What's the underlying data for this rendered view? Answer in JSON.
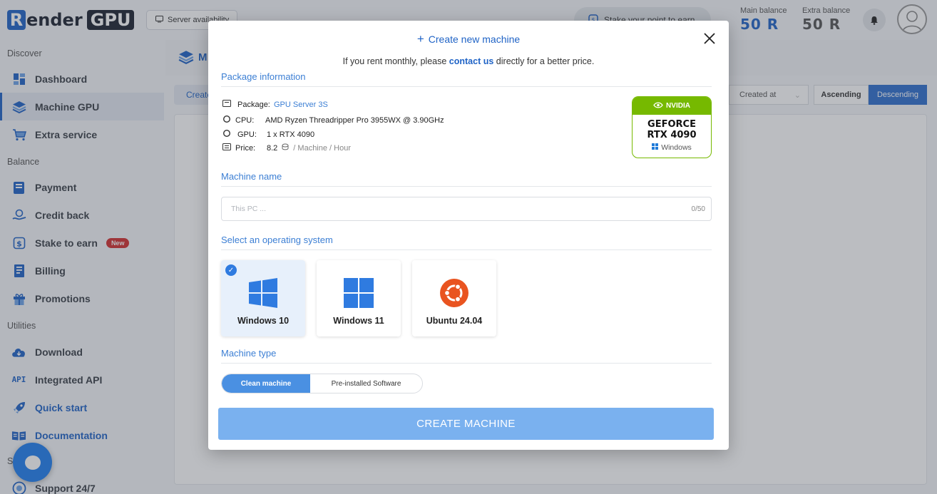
{
  "header": {
    "logo_left": "R",
    "logo_mid": "ender",
    "logo_right": "GPU",
    "server_availability": "Server availability",
    "stake_pill": "Stake your point to earn",
    "main_balance_label": "Main balance",
    "main_balance_value": "50",
    "extra_balance_label": "Extra balance",
    "extra_balance_value": "50"
  },
  "sidebar": {
    "sections": {
      "discover": "Discover",
      "balance": "Balance",
      "utilities": "Utilities",
      "support_cut": "S"
    },
    "items": [
      {
        "label": "Dashboard",
        "icon": "dashboard-icon"
      },
      {
        "label": "Machine GPU",
        "icon": "layers-icon",
        "active": true
      },
      {
        "label": "Extra service",
        "icon": "cart-icon"
      },
      {
        "label": "Payment",
        "icon": "wallet-icon"
      },
      {
        "label": "Credit back",
        "icon": "coin-hand-icon"
      },
      {
        "label": "Stake to earn",
        "icon": "stake-icon",
        "badge": "New"
      },
      {
        "label": "Billing",
        "icon": "billing-icon"
      },
      {
        "label": "Promotions",
        "icon": "gift-icon"
      },
      {
        "label": "Download",
        "icon": "cloud-download-icon"
      },
      {
        "label": "Integrated API",
        "icon": "api-icon"
      },
      {
        "label": "Quick start",
        "icon": "rocket-icon"
      },
      {
        "label": "Documentation",
        "icon": "book-icon"
      },
      {
        "label": "Support 24/7",
        "icon": "support-icon"
      }
    ]
  },
  "background": {
    "page_title_cut": "M",
    "create_tab_cut": "Create",
    "created_at": "Created at",
    "ascending": "Ascending",
    "descending": "Descending"
  },
  "modal": {
    "title_icon": "+",
    "title": "Create new machine",
    "note_before": "If you rent monthly, please",
    "note_link": "contact us",
    "note_after": "directly for a better price.",
    "sections": {
      "package": "Package information",
      "machine_name": "Machine name",
      "os": "Select an operating system",
      "machine_type": "Machine type"
    },
    "package": {
      "package_label": "Package:",
      "package_value": "GPU Server 3S",
      "cpu_label": "CPU:",
      "cpu_value": "AMD Ryzen Threadripper Pro 3955WX @ 3.90GHz",
      "gpu_label": "GPU:",
      "gpu_value": "1 x RTX 4090",
      "price_label": "Price:",
      "price_value": "8.2",
      "price_unit": "/ Machine / Hour"
    },
    "gpu_card": {
      "brand": "NVIDIA",
      "line1": "GEFORCE",
      "line2": "RTX 4090",
      "os": "Windows",
      "accent": "#76b900"
    },
    "name_input": {
      "placeholder": "This PC ...",
      "value": "",
      "counter": "0/50"
    },
    "os_options": [
      {
        "label": "Windows 10",
        "selected": true,
        "icon": "windows-10-icon"
      },
      {
        "label": "Windows 11",
        "selected": false,
        "icon": "windows-11-icon"
      },
      {
        "label": "Ubuntu 24.04",
        "selected": false,
        "icon": "ubuntu-icon"
      }
    ],
    "machine_type": {
      "options": [
        "Clean machine",
        "Pre-installed Software"
      ],
      "selected": "Clean machine"
    },
    "create_button": "CREATE MACHINE"
  },
  "colors": {
    "primary": "#1f63c6",
    "button": "#7ab1ef",
    "nvidia_green": "#76b900",
    "new_badge": "#d32f2f"
  }
}
